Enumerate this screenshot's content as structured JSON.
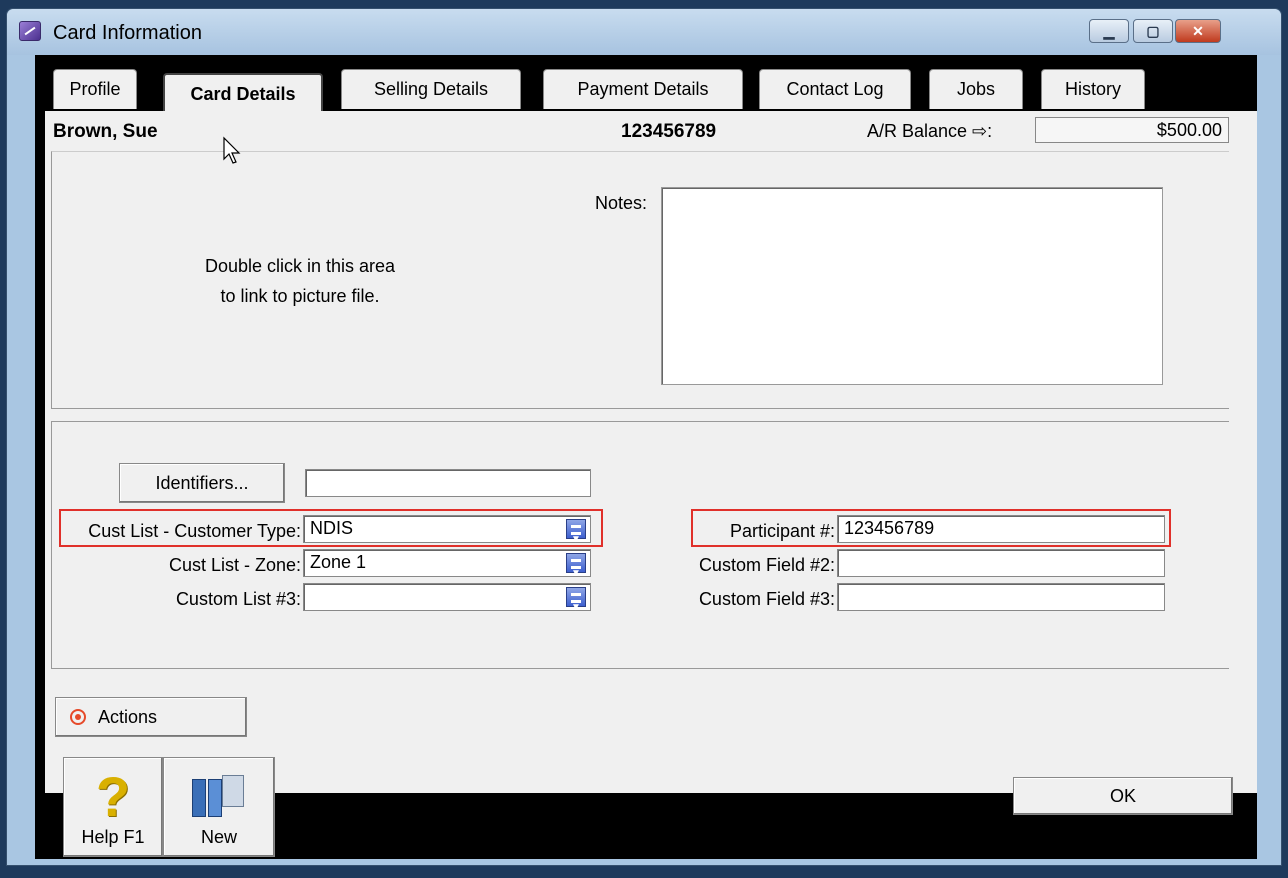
{
  "window": {
    "title": "Card Information"
  },
  "tabs": [
    "Profile",
    "Card Details",
    "Selling Details",
    "Payment Details",
    "Contact Log",
    "Jobs",
    "History"
  ],
  "header": {
    "name": "Brown, Sue",
    "card_id": "123456789",
    "ar_label": "A/R Balance ⇨:",
    "ar_value": "$500.00"
  },
  "picture": {
    "line1": "Double click in this area",
    "line2": "to link to picture file."
  },
  "notes": {
    "label": "Notes:",
    "value": ""
  },
  "identifiers": {
    "button_label": "Identifiers...",
    "value": ""
  },
  "custom_lists": [
    {
      "label": "Cust List - Customer Type:",
      "value": "NDIS"
    },
    {
      "label": "Cust List - Zone:",
      "value": "Zone 1"
    },
    {
      "label": "Custom List #3:",
      "value": ""
    }
  ],
  "custom_fields": [
    {
      "label": "Participant #:",
      "value": "123456789"
    },
    {
      "label": "Custom Field #2:",
      "value": ""
    },
    {
      "label": "Custom Field #3:",
      "value": ""
    }
  ],
  "actions": {
    "label": "Actions"
  },
  "toolbar": {
    "help_label": "Help F1",
    "new_label": "New"
  },
  "ok": {
    "label": "OK"
  },
  "colors": {
    "highlight": "#e0302a",
    "title_bar": "#a9c6e2"
  }
}
